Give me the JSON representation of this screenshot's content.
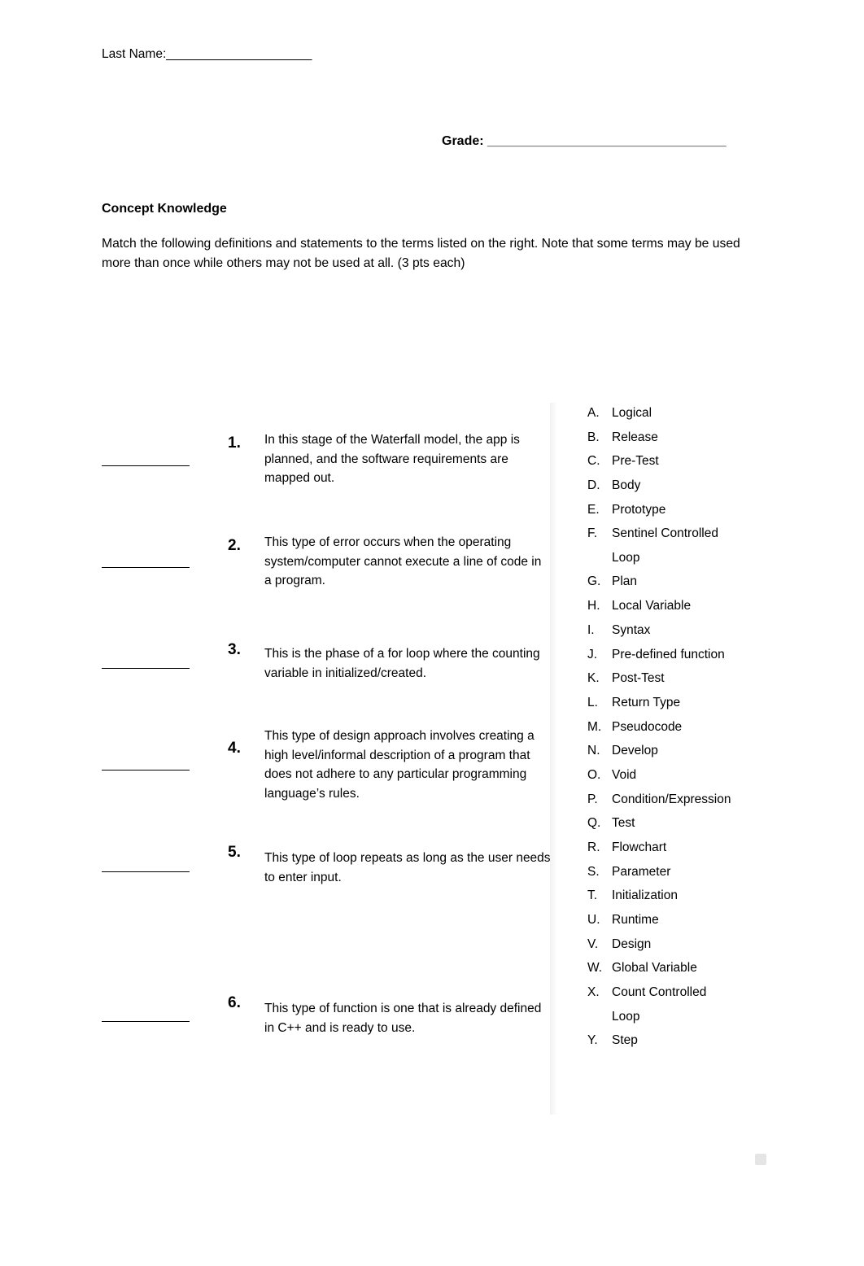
{
  "header": {
    "last_name_label": "Last Name:",
    "last_name_blank": "______________________",
    "grade_label": "Grade:",
    "grade_blank": "_________________________________"
  },
  "section": {
    "title": "Concept Knowledge",
    "instructions": "Match the following definitions and statements to the terms listed on the right.  Note that some terms may be used more than once while others may not be used at all. (3 pts each)"
  },
  "questions": [
    {
      "number": "1.",
      "text": "In this stage of the Waterfall model, the app is planned, and the software requirements are mapped out."
    },
    {
      "number": "2.",
      "text": "This type of error occurs when the operating system/computer cannot execute a line of code in a program."
    },
    {
      "number": "3.",
      "text": "This is the phase of a for loop where the counting variable in initialized/created."
    },
    {
      "number": "4.",
      "text": "This type of design approach involves creating a high level/informal description of a program that does not adhere to any particular programming language’s rules."
    },
    {
      "number": "5.",
      "text": "This type of loop repeats as long as the user needs to enter input."
    },
    {
      "number": "6.",
      "text": "This type of function is one that is already defined in C++ and is ready to use."
    }
  ],
  "terms": [
    {
      "letter": "A.",
      "label": "Logical",
      "cont": ""
    },
    {
      "letter": "B.",
      "label": "Release",
      "cont": ""
    },
    {
      "letter": "C.",
      "label": "Pre-Test",
      "cont": ""
    },
    {
      "letter": "D.",
      "label": "Body",
      "cont": ""
    },
    {
      "letter": "E.",
      "label": "Prototype",
      "cont": ""
    },
    {
      "letter": "F.",
      "label": "Sentinel Controlled",
      "cont": "Loop"
    },
    {
      "letter": "G.",
      "label": "Plan",
      "cont": ""
    },
    {
      "letter": "H.",
      "label": "Local Variable",
      "cont": ""
    },
    {
      "letter": "I.",
      "label": "Syntax",
      "cont": ""
    },
    {
      "letter": "J.",
      "label": "Pre-defined function",
      "cont": ""
    },
    {
      "letter": "K.",
      "label": "Post-Test",
      "cont": ""
    },
    {
      "letter": "L.",
      "label": "Return Type",
      "cont": ""
    },
    {
      "letter": "M.",
      "label": "Pseudocode",
      "cont": ""
    },
    {
      "letter": "N.",
      "label": "Develop",
      "cont": ""
    },
    {
      "letter": "O.",
      "label": "Void",
      "cont": ""
    },
    {
      "letter": "P.",
      "label": "Condition/Expression",
      "cont": ""
    },
    {
      "letter": "Q.",
      "label": "Test",
      "cont": ""
    },
    {
      "letter": "R.",
      "label": "Flowchart",
      "cont": ""
    },
    {
      "letter": "S.",
      "label": "Parameter",
      "cont": ""
    },
    {
      "letter": "T.",
      "label": "Initialization",
      "cont": ""
    },
    {
      "letter": "U.",
      "label": "Runtime",
      "cont": ""
    },
    {
      "letter": "V.",
      "label": "Design",
      "cont": ""
    },
    {
      "letter": "W.",
      "label": "Global Variable",
      "cont": ""
    },
    {
      "letter": "X.",
      "label": "Count Controlled",
      "cont": "Loop"
    },
    {
      "letter": "Y.",
      "label": "Step",
      "cont": ""
    }
  ]
}
